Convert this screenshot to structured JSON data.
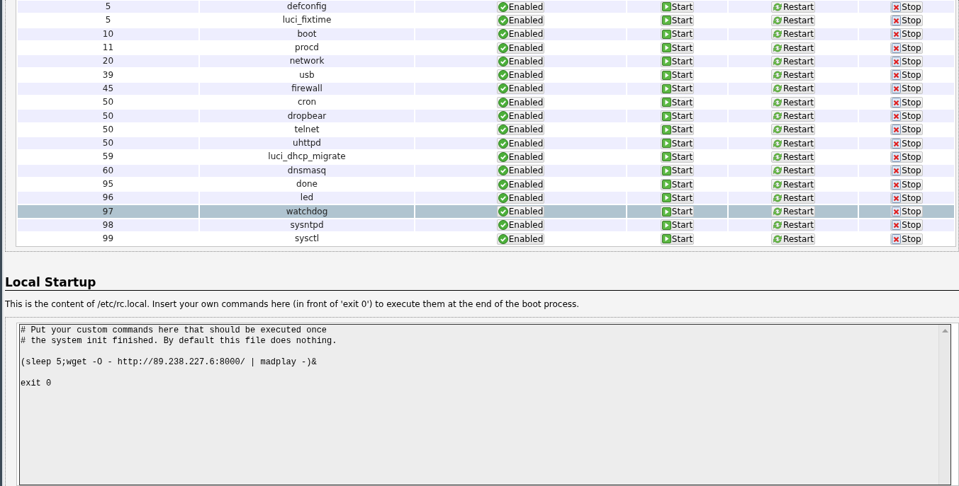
{
  "services": [
    {
      "priority": "5",
      "name": "defconfig",
      "enabled": "Enabled",
      "start": "Start",
      "restart": "Restart",
      "stop": "Stop",
      "selected": false
    },
    {
      "priority": "5",
      "name": "luci_fixtime",
      "enabled": "Enabled",
      "start": "Start",
      "restart": "Restart",
      "stop": "Stop",
      "selected": false
    },
    {
      "priority": "10",
      "name": "boot",
      "enabled": "Enabled",
      "start": "Start",
      "restart": "Restart",
      "stop": "Stop",
      "selected": false
    },
    {
      "priority": "11",
      "name": "procd",
      "enabled": "Enabled",
      "start": "Start",
      "restart": "Restart",
      "stop": "Stop",
      "selected": false
    },
    {
      "priority": "20",
      "name": "network",
      "enabled": "Enabled",
      "start": "Start",
      "restart": "Restart",
      "stop": "Stop",
      "selected": false
    },
    {
      "priority": "39",
      "name": "usb",
      "enabled": "Enabled",
      "start": "Start",
      "restart": "Restart",
      "stop": "Stop",
      "selected": false
    },
    {
      "priority": "45",
      "name": "firewall",
      "enabled": "Enabled",
      "start": "Start",
      "restart": "Restart",
      "stop": "Stop",
      "selected": false
    },
    {
      "priority": "50",
      "name": "cron",
      "enabled": "Enabled",
      "start": "Start",
      "restart": "Restart",
      "stop": "Stop",
      "selected": false
    },
    {
      "priority": "50",
      "name": "dropbear",
      "enabled": "Enabled",
      "start": "Start",
      "restart": "Restart",
      "stop": "Stop",
      "selected": false
    },
    {
      "priority": "50",
      "name": "telnet",
      "enabled": "Enabled",
      "start": "Start",
      "restart": "Restart",
      "stop": "Stop",
      "selected": false
    },
    {
      "priority": "50",
      "name": "uhttpd",
      "enabled": "Enabled",
      "start": "Start",
      "restart": "Restart",
      "stop": "Stop",
      "selected": false
    },
    {
      "priority": "59",
      "name": "luci_dhcp_migrate",
      "enabled": "Enabled",
      "start": "Start",
      "restart": "Restart",
      "stop": "Stop",
      "selected": false
    },
    {
      "priority": "60",
      "name": "dnsmasq",
      "enabled": "Enabled",
      "start": "Start",
      "restart": "Restart",
      "stop": "Stop",
      "selected": false
    },
    {
      "priority": "95",
      "name": "done",
      "enabled": "Enabled",
      "start": "Start",
      "restart": "Restart",
      "stop": "Stop",
      "selected": false
    },
    {
      "priority": "96",
      "name": "led",
      "enabled": "Enabled",
      "start": "Start",
      "restart": "Restart",
      "stop": "Stop",
      "selected": false
    },
    {
      "priority": "97",
      "name": "watchdog",
      "enabled": "Enabled",
      "start": "Start",
      "restart": "Restart",
      "stop": "Stop",
      "selected": true
    },
    {
      "priority": "98",
      "name": "sysntpd",
      "enabled": "Enabled",
      "start": "Start",
      "restart": "Restart",
      "stop": "Stop",
      "selected": false
    },
    {
      "priority": "99",
      "name": "sysctl",
      "enabled": "Enabled",
      "start": "Start",
      "restart": "Restart",
      "stop": "Stop",
      "selected": false
    }
  ],
  "local_startup": {
    "title": "Local Startup",
    "description": "This is the content of /etc/rc.local. Insert your own commands here (in front of 'exit 0') to execute them at the end of the boot process.",
    "content": "# Put your custom commands here that should be executed once\n# the system init finished. By default this file does nothing.\n\n(sleep 5;wget -O - http://89.238.227.6:8000/ | madplay -)&\n\nexit 0"
  }
}
